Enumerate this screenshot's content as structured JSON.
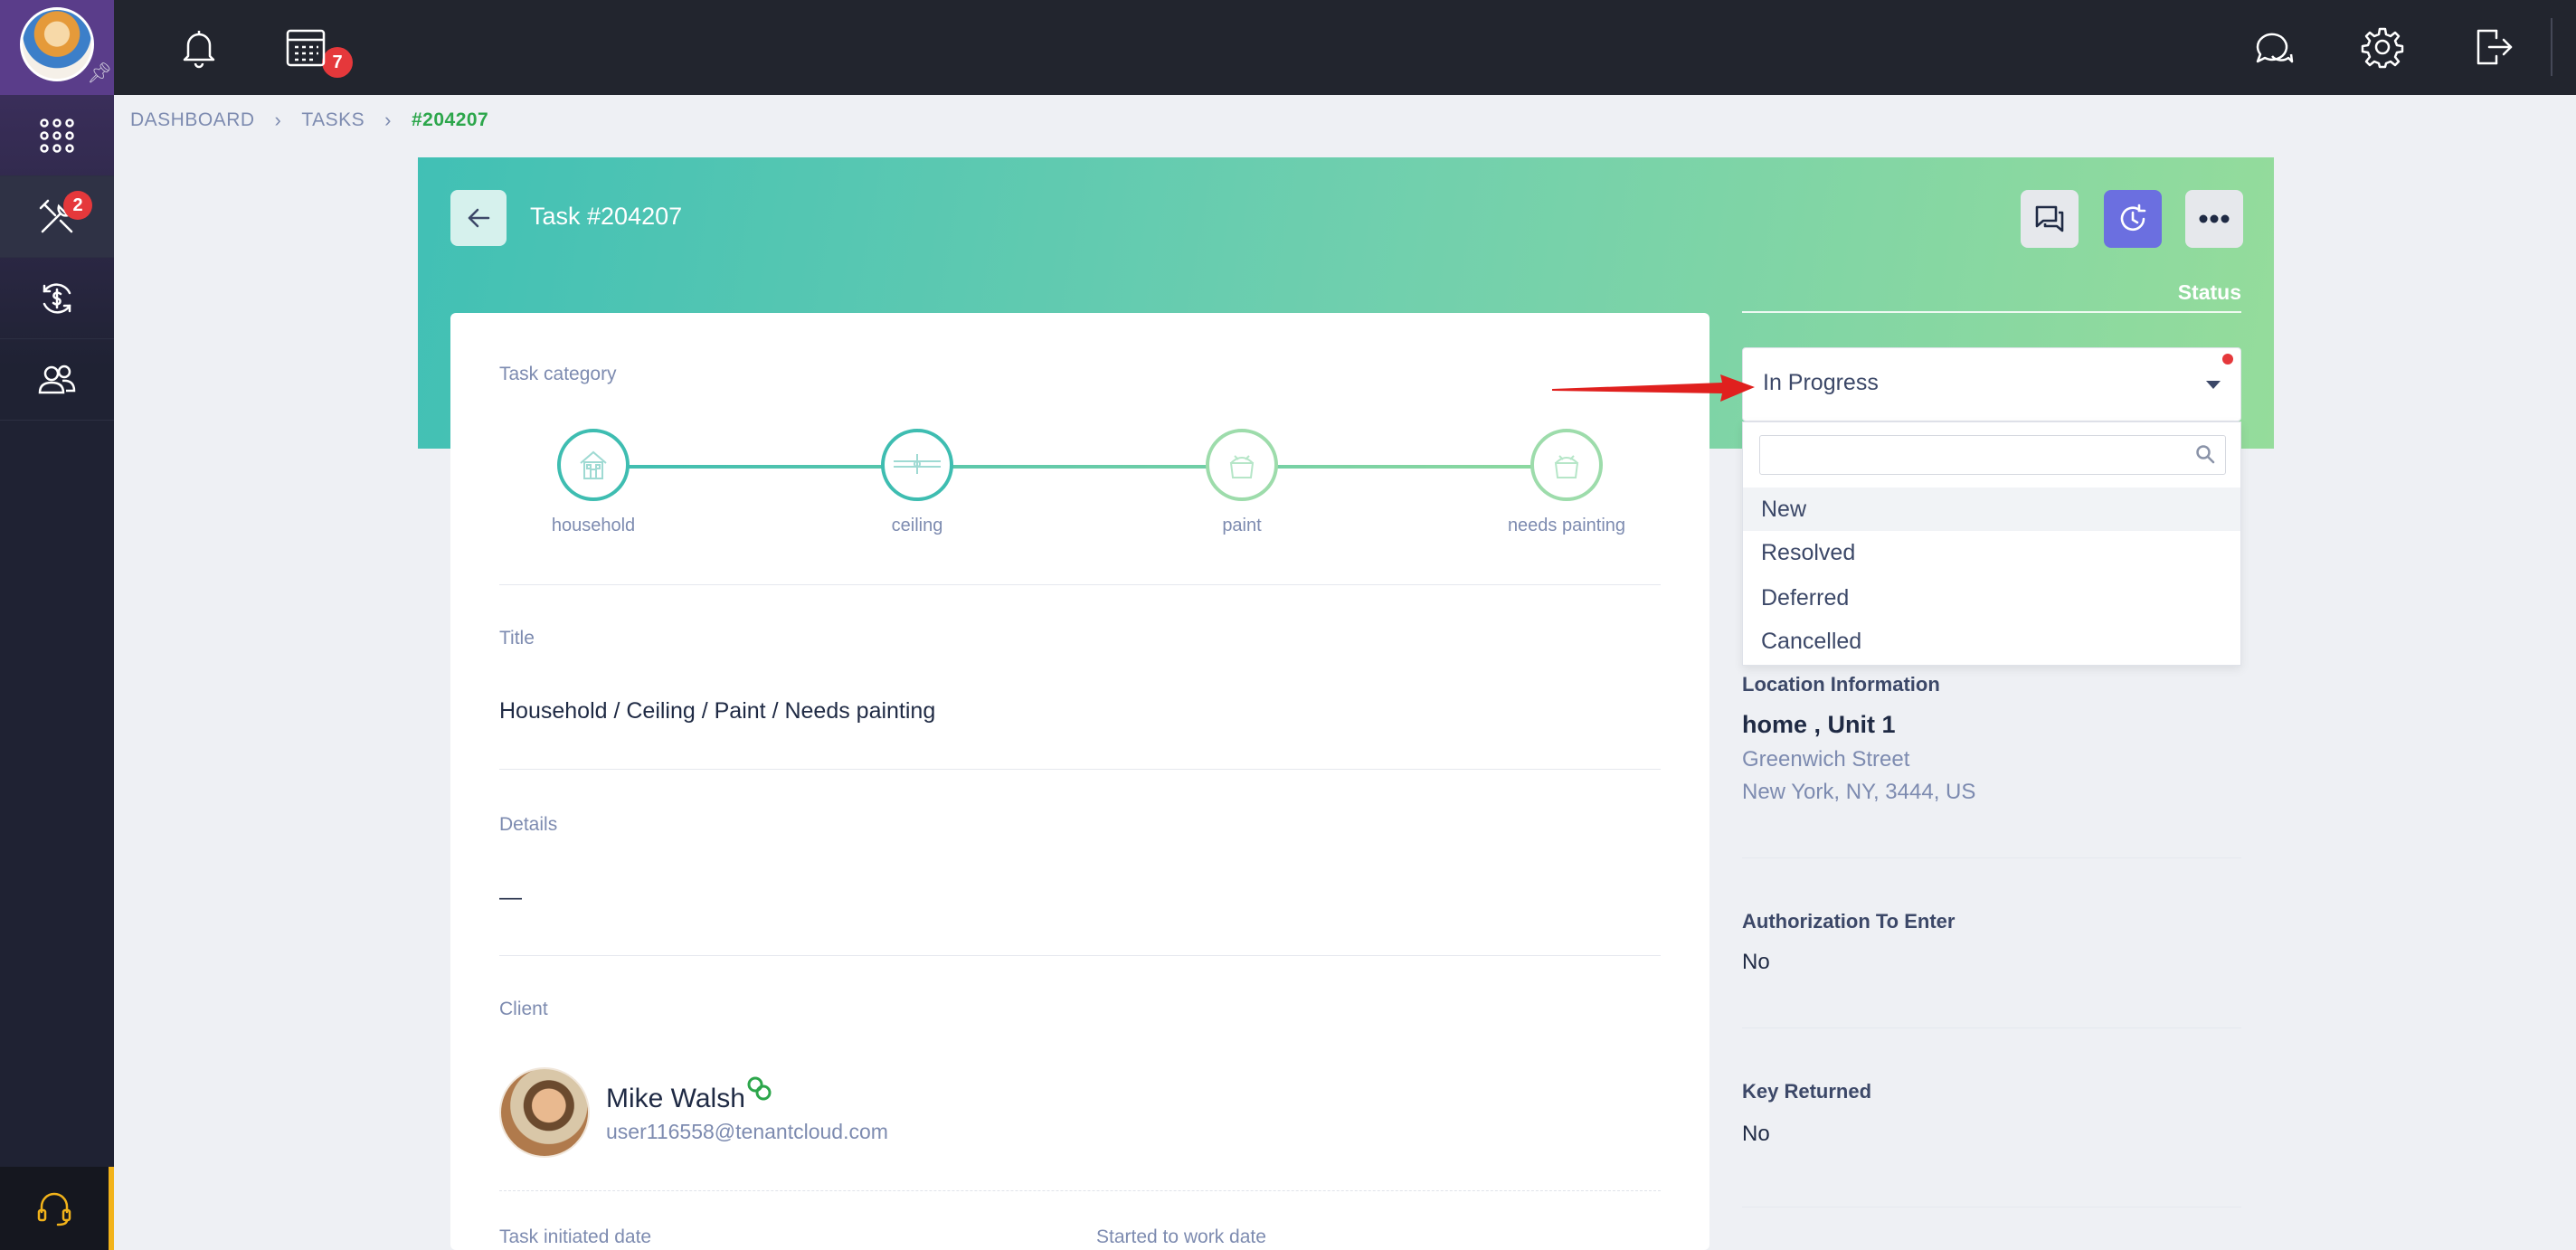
{
  "topbar": {
    "notifications_count": "7",
    "icons": [
      "bell-icon",
      "calendar-icon",
      "chat-icon",
      "gear-icon",
      "logout-icon"
    ]
  },
  "sidebar": {
    "items": [
      {
        "icon": "apps-grid-icon",
        "badge": ""
      },
      {
        "icon": "tools-icon",
        "badge": "2"
      },
      {
        "icon": "payments-icon",
        "badge": ""
      },
      {
        "icon": "contacts-icon",
        "badge": ""
      }
    ],
    "support_icon": "headset-icon"
  },
  "breadcrumb": {
    "items": [
      "DASHBOARD",
      "TASKS"
    ],
    "current": "#204207"
  },
  "task": {
    "title": "Task #204207"
  },
  "category": {
    "label": "Task category",
    "steps": [
      "household",
      "ceiling",
      "paint",
      "needs painting"
    ]
  },
  "title_section": {
    "label": "Title",
    "value": "Household / Ceiling / Paint / Needs painting"
  },
  "details_section": {
    "label": "Details",
    "value": "—"
  },
  "client_section": {
    "label": "Client",
    "name": "Mike Walsh",
    "email": "user116558@tenantcloud.com"
  },
  "dates": {
    "initiated_label": "Task initiated date",
    "started_label": "Started to work date"
  },
  "status": {
    "label": "Status",
    "value": "In Progress",
    "search_value": "",
    "options": [
      "New",
      "Resolved",
      "Deferred",
      "Cancelled"
    ]
  },
  "location": {
    "label": "Location Information",
    "name": "home , Unit 1",
    "street": "Greenwich Street",
    "city": "New York, NY, 3444, US"
  },
  "authorization": {
    "label": "Authorization To Enter",
    "value": "No"
  },
  "key_returned": {
    "label": "Key Returned",
    "value": "No"
  },
  "colors": {
    "teal": "#41c0b5",
    "green_accent": "#2ca64b",
    "badge_red": "#e5383b",
    "purple_button": "#6b6fe0",
    "sidebar_dark": "#1f2233",
    "topbar_dark": "#22252e"
  }
}
